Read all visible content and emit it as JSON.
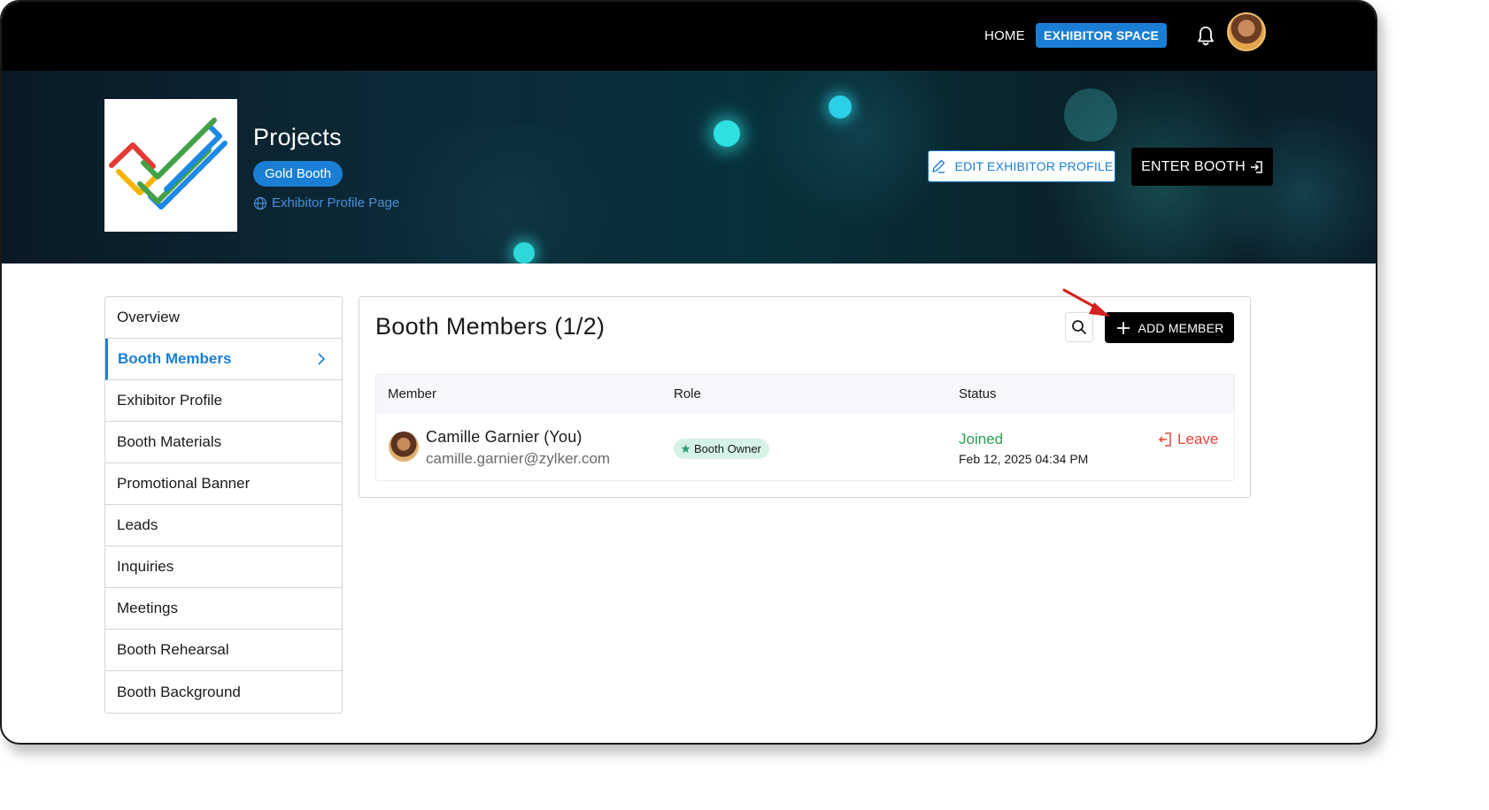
{
  "topbar": {
    "nav_home": "HOME",
    "nav_exhibitor_space": "EXHIBITOR SPACE",
    "icons": [
      "bell-icon",
      "user-avatar"
    ]
  },
  "banner": {
    "title": "Projects",
    "badge": "Gold Booth",
    "profile_link": "Exhibitor Profile Page",
    "edit_button": "EDIT EXHIBITOR PROFILE",
    "enter_button": "ENTER BOOTH"
  },
  "sidebar": {
    "items": [
      {
        "label": "Overview"
      },
      {
        "label": "Booth Members",
        "active": true
      },
      {
        "label": "Exhibitor Profile"
      },
      {
        "label": "Booth Materials"
      },
      {
        "label": "Promotional Banner"
      },
      {
        "label": "Leads"
      },
      {
        "label": "Inquiries"
      },
      {
        "label": "Meetings"
      },
      {
        "label": "Booth Rehearsal"
      },
      {
        "label": "Booth Background"
      }
    ]
  },
  "main": {
    "title": "Booth Members (1/2)",
    "add_button": "ADD MEMBER",
    "table": {
      "headers": [
        "Member",
        "Role",
        "Status"
      ],
      "rows": [
        {
          "name": "Camille Garnier (You)",
          "email": "camille.garnier@zylker.com",
          "role": "Booth Owner",
          "status": "Joined",
          "date": "Feb 12, 2025 04:34 PM",
          "action": "Leave"
        }
      ]
    }
  },
  "colors": {
    "accent": "#1a7fd4",
    "joined": "#2e9e4f",
    "leave": "#e8453c",
    "role_badge_bg": "#d6f2e6",
    "annotation_arrow": "#d42020"
  }
}
